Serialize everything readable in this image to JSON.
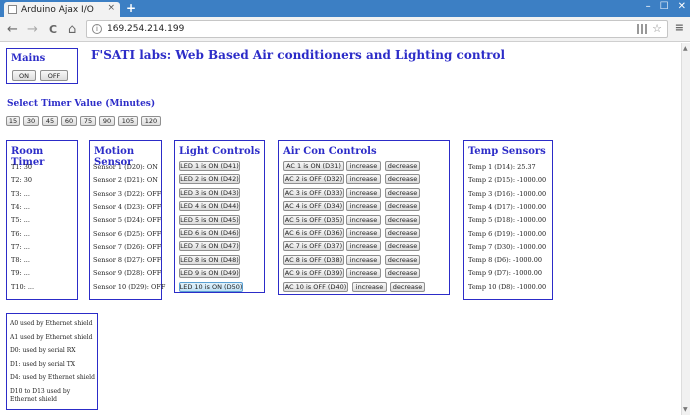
{
  "browser": {
    "tab_title": "Arduino Ajax I/O",
    "tab_close": "×",
    "new_tab": "+",
    "window_controls": [
      "–",
      "☐",
      "✕"
    ],
    "back": "←",
    "forward": "→",
    "reload": "C",
    "home": "⌂",
    "address": "169.254.214.199",
    "star": "☆",
    "menu": "≡"
  },
  "page_title": "F'SATI labs: Web Based Air conditioners and Lighting control",
  "mains": {
    "title": "Mains",
    "on_label": "ON",
    "off_label": "OFF"
  },
  "timer": {
    "title": "Select Timer Value (Minutes)",
    "values": [
      "15",
      "30",
      "45",
      "60",
      "75",
      "90",
      "105",
      "120"
    ]
  },
  "room_timer": {
    "title": "Room Timer",
    "items": [
      "T1: 30",
      "T2: 30",
      "T3: ...",
      "T4: ...",
      "T5: ...",
      "T6: ...",
      "T7: ...",
      "T8: ...",
      "T9: ...",
      "T10: ..."
    ]
  },
  "motion_sensor": {
    "title": "Motion Sensor",
    "items": [
      "Sensor 1 (D20): ON",
      "Sensor 2 (D21): ON",
      "Sensor 3 (D22): OFF",
      "Sensor 4 (D23): OFF",
      "Sensor 5 (D24): OFF",
      "Sensor 6 (D25): OFF",
      "Sensor 7 (D26): OFF",
      "Sensor 8 (D27): OFF",
      "Sensor 9 (D28): OFF",
      "Sensor 10 (D29): OFF"
    ]
  },
  "light_controls": {
    "title": "Light Controls",
    "items": [
      "LED 1 is ON (D41)",
      "LED 2 is ON (D42)",
      "LED 3 is ON (D43)",
      "LED 4 is ON (D44)",
      "LED 5 is ON (D45)",
      "LED 6 is ON (D46)",
      "LED 7 is ON (D47)",
      "LED 8 is ON (D48)",
      "LED 9 is ON (D49)",
      "LED 10 is ON (D50)"
    ]
  },
  "aircon_controls": {
    "title": "Air Con Controls",
    "items": [
      "AC 1 is ON (D31)",
      "AC 2 is OFF (D32)",
      "AC 3 is OFF (D33)",
      "AC 4 is OFF (D34)",
      "AC 5 is OFF (D35)",
      "AC 6 is OFF (D36)",
      "AC 7 is OFF (D37)",
      "AC 8 is OFF (D38)",
      "AC 9 is OFF (D39)",
      "AC 10 is OFF (D40)"
    ],
    "increase_label": "increase",
    "decrease_label": "decrease"
  },
  "temp_sensors": {
    "title": "Temp Sensors",
    "items": [
      "Temp 1 (D14): 25.37",
      "Temp 2 (D15): -1000.00",
      "Temp 3 (D16): -1000.00",
      "Temp 4 (D17): -1000.00",
      "Temp 5 (D18): -1000.00",
      "Temp 6 (D19): -1000.00",
      "Temp 7 (D30): -1000.00",
      "Temp 8 (D6): -1000.00",
      "Temp 9 (D7): -1000.00",
      "Temp 10 (D8): -1000.00"
    ]
  },
  "pin_notes": [
    "A0 used by Ethernet shield",
    "A1 used by Ethernet shield",
    "D0: used by serial RX",
    "D1: used by serial TX",
    "D4: used by Ethernet shield",
    "D10 to D13 used by Ethernet shield"
  ]
}
